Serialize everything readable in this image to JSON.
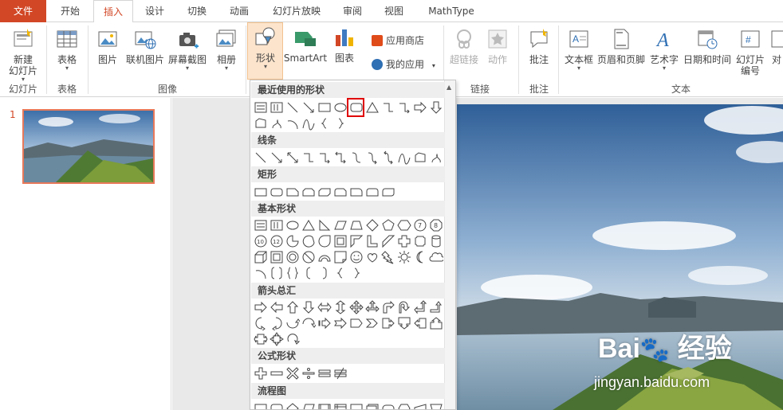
{
  "tabs": {
    "file": "文件",
    "home": "开始",
    "insert": "插入",
    "design": "设计",
    "transitions": "切换",
    "animations": "动画",
    "slideshow": "幻灯片放映",
    "review": "审阅",
    "view": "视图",
    "mathtype": "MathType"
  },
  "ribbon": {
    "new_slide": "新建",
    "new_slide_2": "幻灯片",
    "table": "表格",
    "picture": "图片",
    "online_picture": "联机图片",
    "screenshot": "屏幕截图",
    "album": "相册",
    "shapes": "形状",
    "smartart": "SmartArt",
    "chart": "图表",
    "app_store": "应用商店",
    "my_apps": "我的应用",
    "hyperlink": "超链接",
    "action": "动作",
    "comment": "批注",
    "textbox": "文本框",
    "header_footer": "页眉和页脚",
    "wordart": "艺术字",
    "datetime": "日期和时间",
    "slide_number": "幻灯片",
    "slide_number_2": "编号",
    "object_partial": "对",
    "groups": {
      "slides": "幻灯片",
      "tables": "表格",
      "images": "图像",
      "links": "链接",
      "comments": "批注",
      "text": "文本"
    }
  },
  "thumbnail": {
    "slide_number": "1"
  },
  "dropdown": {
    "sections": {
      "recent": "最近使用的形状",
      "lines": "线条",
      "rectangles": "矩形",
      "basic": "基本形状",
      "arrows": "箭头总汇",
      "equation": "公式形状",
      "flowchart": "流程图"
    }
  },
  "watermark": {
    "brand": "Bai",
    "brand_cn": "经验",
    "url": "jingyan.baidu.com"
  },
  "colors": {
    "accent": "#d24726",
    "highlight": "#e00000",
    "shape_stroke": "#444444"
  }
}
